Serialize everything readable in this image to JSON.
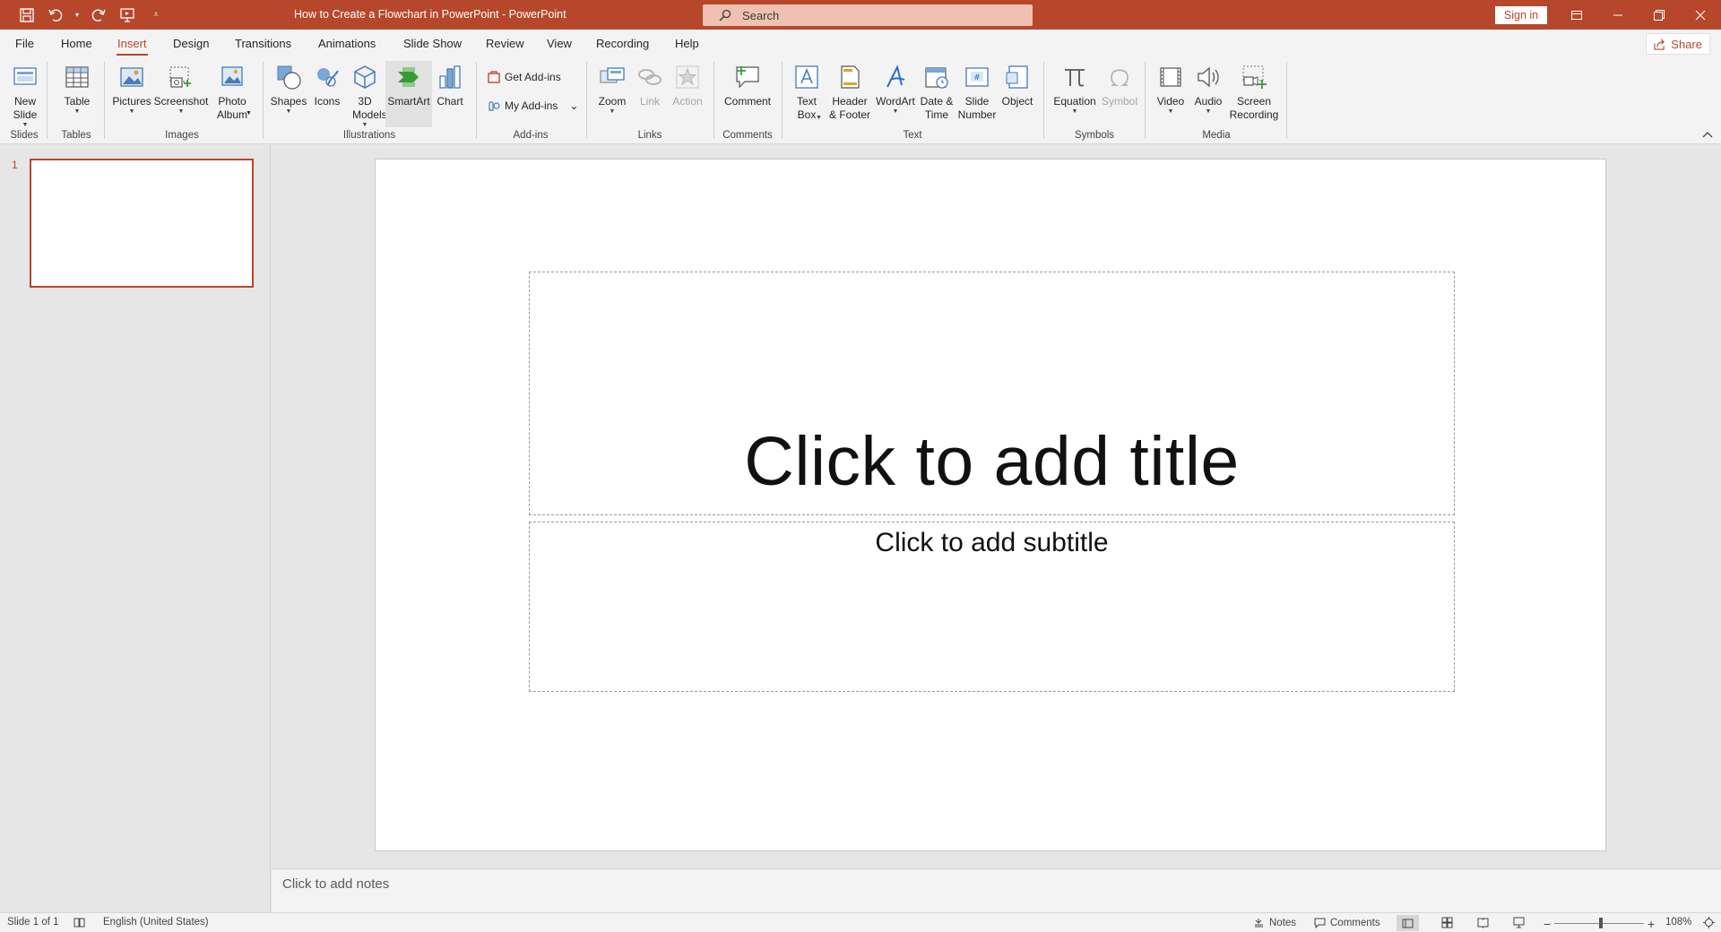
{
  "titlebar": {
    "doc_title": "How to Create a Flowchart in PowerPoint  -  PowerPoint",
    "search_placeholder": "Search",
    "signin_label": "Sign in"
  },
  "tabs": [
    "File",
    "Home",
    "Insert",
    "Design",
    "Transitions",
    "Animations",
    "Slide Show",
    "Review",
    "View",
    "Recording",
    "Help"
  ],
  "active_tab": "Insert",
  "share_label": "Share",
  "ribbon": {
    "new_slide": "New Slide",
    "table": "Table",
    "pictures": "Pictures",
    "screenshot": "Screenshot",
    "photo_album": "Photo Album",
    "shapes": "Shapes",
    "icons": "Icons",
    "models_3d": "3D Models",
    "smartart": "SmartArt",
    "chart": "Chart",
    "get_addins": "Get Add-ins",
    "my_addins": "My Add-ins",
    "zoom": "Zoom",
    "link": "Link",
    "action": "Action",
    "comment": "Comment",
    "text_box": "Text Box",
    "header_footer": "Header & Footer",
    "wordart": "WordArt",
    "date_time": "Date & Time",
    "slide_number": "Slide Number",
    "object": "Object",
    "equation": "Equation",
    "symbol": "Symbol",
    "video": "Video",
    "audio": "Audio",
    "screen_recording": "Screen Recording",
    "groups": {
      "slides": "Slides",
      "tables": "Tables",
      "images": "Images",
      "illustrations": "Illustrations",
      "addins": "Add-ins",
      "links": "Links",
      "comments": "Comments",
      "text": "Text",
      "symbols": "Symbols",
      "media": "Media"
    }
  },
  "thumbnail": {
    "number": "1"
  },
  "slide": {
    "title_placeholder": "Click to add title",
    "subtitle_placeholder": "Click to add subtitle"
  },
  "notes_placeholder": "Click to add notes",
  "status": {
    "slide_info": "Slide 1 of 1",
    "language": "English (United States)",
    "notes": "Notes",
    "comments": "Comments",
    "zoom": "108%"
  },
  "colors": {
    "accent": "#b7472a",
    "ribbon_bg": "#f3f3f3",
    "workspace_bg": "#e6e6e6"
  }
}
